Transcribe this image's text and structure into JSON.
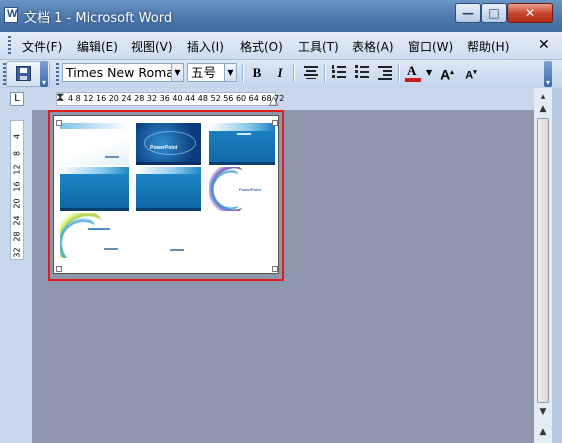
{
  "window": {
    "title": "文档 1 - Microsoft Word",
    "minimize_glyph": "—",
    "maximize_glyph": "□",
    "close_glyph": "✕"
  },
  "menu": {
    "items": [
      "文件(F)",
      "编辑(E)",
      "视图(V)",
      "插入(I)",
      "格式(O)",
      "工具(T)",
      "表格(A)",
      "窗口(W)",
      "帮助(H)"
    ],
    "close_glyph": "✕"
  },
  "toolbar": {
    "font_name": "Times New Roman",
    "font_size": "五号",
    "bold_label": "B",
    "italic_label": "I",
    "font_color_label": "A",
    "font_color": "#d01a1a",
    "grow_font_label": "A",
    "shrink_font_label": "A",
    "icons": [
      "save-icon",
      "align-center-icon",
      "numbered-list-icon",
      "bullet-list-icon",
      "font-color-icon",
      "grow-font-icon",
      "shrink-font-icon"
    ]
  },
  "ruler": {
    "tab_selector_glyph": "L",
    "horizontal_numbers": "4  8 12 16 20 24 28 32 36 40 44 48 52 56 60 64 68 72",
    "vertical_numbers": [
      "4",
      "8",
      "12",
      "16",
      "20",
      "24",
      "28",
      "32"
    ]
  },
  "document": {
    "highlight_color": "#e21b1b",
    "thumbnails": [
      {
        "style": "white-blue"
      },
      {
        "style": "blue-tech",
        "caption": "PowerPoint"
      },
      {
        "style": "blue-solid"
      },
      {
        "style": "blue-solid"
      },
      {
        "style": "blue-solid"
      },
      {
        "style": "purple-swirl",
        "caption": "PowerPoint"
      },
      {
        "style": "green-swirl"
      },
      {
        "style": "white-plain"
      }
    ]
  },
  "scrollbar": {
    "up_glyph": "▲",
    "down_glyph": "▼",
    "page_glyph": "▴"
  }
}
